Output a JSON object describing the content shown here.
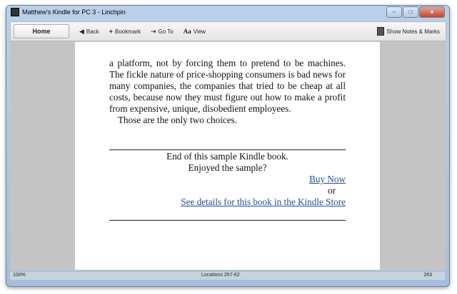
{
  "window": {
    "title": "Matthew's Kindle for PC 3 - Linchpin",
    "close": "x"
  },
  "toolbar": {
    "home": "Home",
    "back": "Back",
    "bookmark": "Bookmark",
    "goto": "Go To",
    "view": "View",
    "view_icon": "Aa",
    "notes": "Show Notes & Marks"
  },
  "book": {
    "paragraph1": "a platform, not by forcing them to pretend to be machines. The fickle nature of price-shopping consumers is bad news for many companies, the companies that tried to be cheap at all costs, because now they must figure out how to make a profit from expensive, unique, disobedient employees.",
    "paragraph2": "Those are the only two choices.",
    "end_text": "End of this sample Kindle book.",
    "enjoyed": "Enjoyed the sample?",
    "buy_now": "Buy Now",
    "or": "or",
    "details_link": "See details for this book in the Kindle Store"
  },
  "status": {
    "zoom": "100%",
    "locations": "Locations 257-62",
    "total": "263"
  }
}
